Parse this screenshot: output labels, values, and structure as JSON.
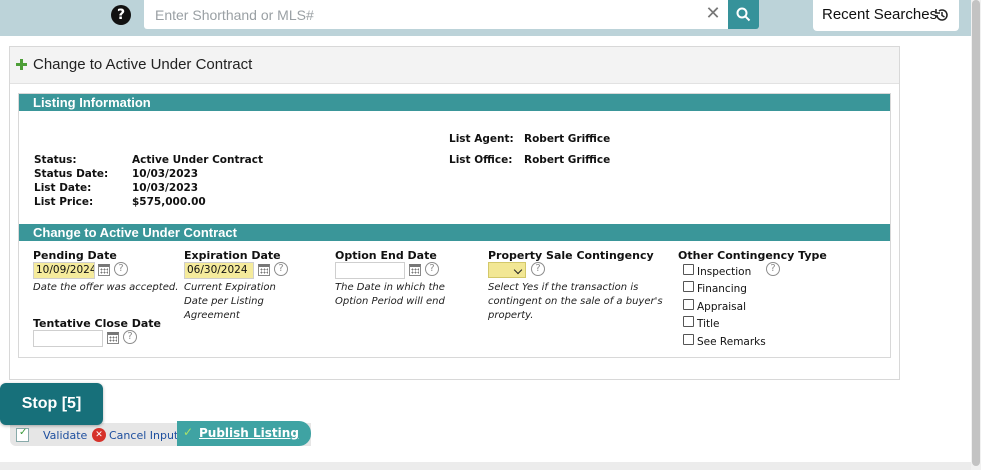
{
  "search": {
    "placeholder": "Enter Shorthand or MLS#",
    "clear": "✕",
    "recent_label": "Recent Searches"
  },
  "help": {
    "glyph": "?"
  },
  "panel": {
    "title": "Change to Active Under Contract"
  },
  "listing_info": {
    "header": "Listing Information",
    "status_label": "Status:",
    "status_value": "Active Under Contract",
    "status_date_label": "Status Date:",
    "status_date_value": "10/03/2023",
    "list_date_label": "List Date:",
    "list_date_value": "10/03/2023",
    "list_price_label": "List Price:",
    "list_price_value": "$575,000.00",
    "agent_label": "List Agent:",
    "agent_value": "Robert Griffice",
    "office_label": "List Office:",
    "office_value": "Robert Griffice"
  },
  "change_form": {
    "header": "Change to Active Under Contract",
    "pending_date": {
      "label": "Pending Date",
      "value": "10/09/2024",
      "hint": "Date the offer was accepted."
    },
    "expiration_date": {
      "label": "Expiration Date",
      "value": "06/30/2024",
      "hint_lines": [
        "Current Expiration",
        "Date per Listing",
        "Agreement"
      ]
    },
    "option_end_date": {
      "label": "Option End Date",
      "value": "",
      "hint_lines": [
        "The Date in which the",
        "Option Period will end"
      ]
    },
    "tentative_close_date": {
      "label": "Tentative Close Date",
      "value": ""
    },
    "property_sale_contingency": {
      "label": "Property Sale Contingency",
      "hint_lines": [
        "Select Yes if the transaction is",
        "contingent on the sale of a buyer's",
        "property."
      ]
    },
    "other_contingency": {
      "label": "Other Contingency Type",
      "options": [
        "Inspection",
        "Financing",
        "Appraisal",
        "Title",
        "See Remarks"
      ]
    }
  },
  "help_glyph": "?",
  "actions": {
    "stop_label": "Stop [5]",
    "validate_label": "Validate",
    "cancel_label": "Cancel Input",
    "publish_label": "Publish Listing",
    "cancel_glyph": "✕",
    "publish_glyph": "✓"
  },
  "colors": {
    "accent": "#3a9699",
    "stop": "#17707a",
    "highlight": "#f5eb9c"
  }
}
